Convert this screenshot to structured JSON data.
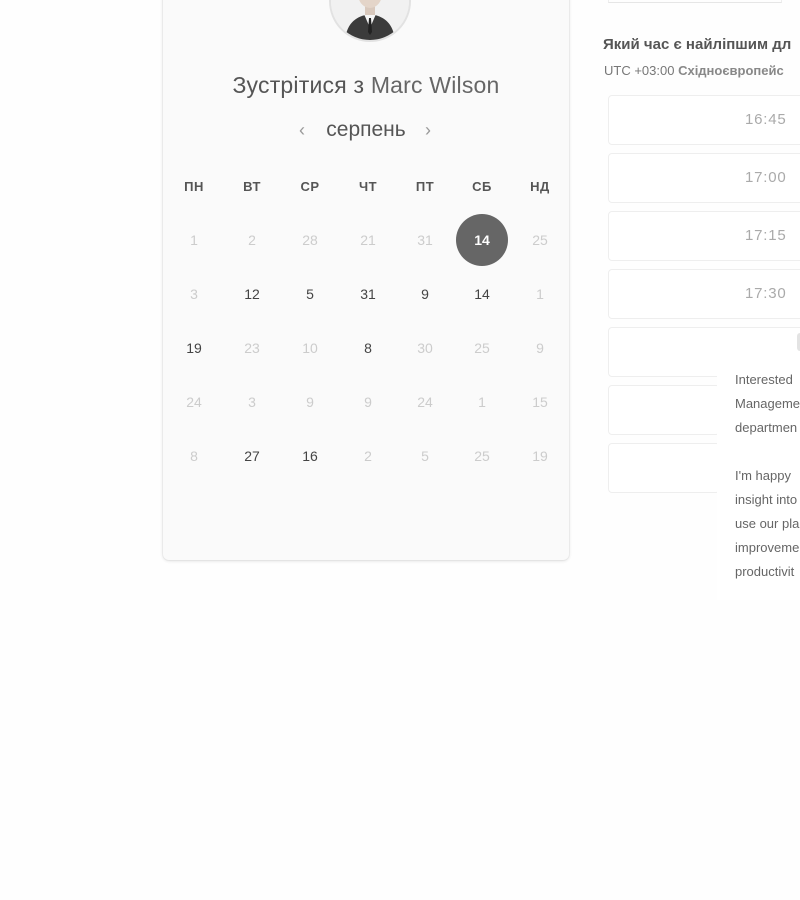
{
  "scheduler": {
    "title_prefix": "Зустрітися з",
    "host_name": "Marc Wilson",
    "month": "серпень",
    "weekdays": [
      "ПН",
      "ВТ",
      "СР",
      "ЧТ",
      "ПТ",
      "СБ",
      "НД"
    ],
    "weeks": [
      [
        {
          "d": "1",
          "a": false
        },
        {
          "d": "2",
          "a": false
        },
        {
          "d": "28",
          "a": false
        },
        {
          "d": "21",
          "a": false
        },
        {
          "d": "31",
          "a": false
        },
        {
          "d": "14",
          "a": true,
          "sel": true
        },
        {
          "d": "25",
          "a": false
        }
      ],
      [
        {
          "d": "3",
          "a": false
        },
        {
          "d": "12",
          "a": true
        },
        {
          "d": "5",
          "a": true
        },
        {
          "d": "31",
          "a": true
        },
        {
          "d": "9",
          "a": true
        },
        {
          "d": "14",
          "a": true
        },
        {
          "d": "1",
          "a": false
        }
      ],
      [
        {
          "d": "19",
          "a": true
        },
        {
          "d": "23",
          "a": false
        },
        {
          "d": "10",
          "a": false
        },
        {
          "d": "8",
          "a": true
        },
        {
          "d": "30",
          "a": false
        },
        {
          "d": "25",
          "a": false
        },
        {
          "d": "9",
          "a": false
        }
      ],
      [
        {
          "d": "24",
          "a": false
        },
        {
          "d": "3",
          "a": false
        },
        {
          "d": "9",
          "a": false
        },
        {
          "d": "9",
          "a": false
        },
        {
          "d": "24",
          "a": false
        },
        {
          "d": "1",
          "a": false
        },
        {
          "d": "15",
          "a": false
        }
      ],
      [
        {
          "d": "8",
          "a": false
        },
        {
          "d": "27",
          "a": true
        },
        {
          "d": "16",
          "a": true
        },
        {
          "d": "2",
          "a": false
        },
        {
          "d": "5",
          "a": false
        },
        {
          "d": "25",
          "a": false
        },
        {
          "d": "19",
          "a": false
        }
      ]
    ]
  },
  "times": {
    "question": "Який час є найліпшим дл",
    "timezone_offset": "UTC +03:00",
    "timezone_name": "Східноєвропейс",
    "slots": [
      "16:45",
      "17:00",
      "17:15",
      "17:30"
    ]
  },
  "tooltip": {
    "lines": [
      "Interested",
      "Manageme",
      "departmen",
      "",
      "I'm happy",
      "insight into",
      "use our pla",
      "improveme",
      "productivit"
    ]
  }
}
